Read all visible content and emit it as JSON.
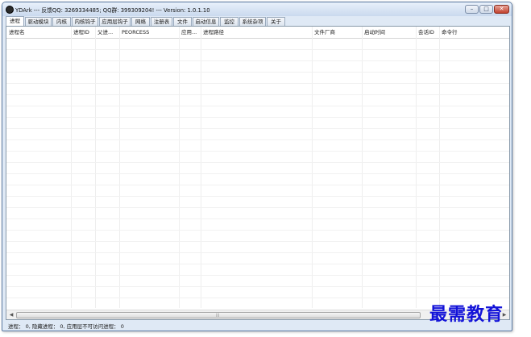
{
  "window": {
    "title": "YDArk --- 反馈QQ: 3269334485; QQ群: 399309204! --- Version: 1.0.1.10",
    "controls": {
      "minimize": "–",
      "maximize": "□",
      "close": "✕"
    },
    "accent_colors": {
      "frame": "#5b7aa3",
      "close": "#c1402d"
    }
  },
  "tabs": [
    "进程",
    "驱动模块",
    "内核",
    "内核钩子",
    "应用层钩子",
    "网络",
    "注册表",
    "文件",
    "启动信息",
    "监控",
    "系统杂项",
    "关于"
  ],
  "table": {
    "columns": [
      "进程名",
      "进程ID",
      "父进...",
      "PEORCESS",
      "应用...",
      "进程路径",
      "文件厂商",
      "启动时间",
      "会话ID",
      "命令行"
    ],
    "rows": []
  },
  "scrollbar": {
    "left": "◀",
    "right": "▶",
    "grip": "|||"
  },
  "statusbar": {
    "text": "进程： 0, 隐藏进程： 0, 应用层不可访问进程： 0"
  },
  "watermark": {
    "text": "最需教育"
  }
}
